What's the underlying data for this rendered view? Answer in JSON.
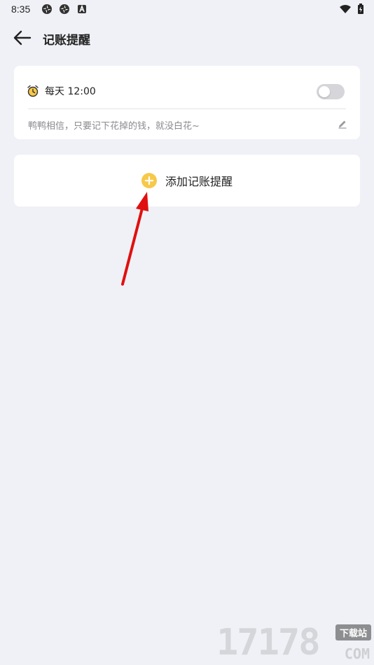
{
  "status_bar": {
    "time": "8:35",
    "left_icons": [
      "app-icon-1",
      "app-icon-2",
      "a-icon"
    ],
    "right_icons": [
      "wifi-icon",
      "battery-icon"
    ]
  },
  "header": {
    "title": "记账提醒",
    "back_icon": "back-arrow-icon"
  },
  "reminder": {
    "time_label": "每天 12:00",
    "enabled": false,
    "note": "鸭鸭相信，只要记下花掉的钱，就没白花~",
    "icon": "alarm-clock-icon",
    "edit_icon": "pencil-icon"
  },
  "add_reminder": {
    "label": "添加记账提醒",
    "icon": "plus-circle-icon"
  },
  "watermark": {
    "digits": "17178",
    "badge": "下载站",
    "suffix": "COM"
  },
  "colors": {
    "background": "#f0f1f6",
    "card": "#ffffff",
    "accent_yellow": "#f7c948",
    "toggle_off": "#d6d6da",
    "annotation_red": "#e01010"
  }
}
